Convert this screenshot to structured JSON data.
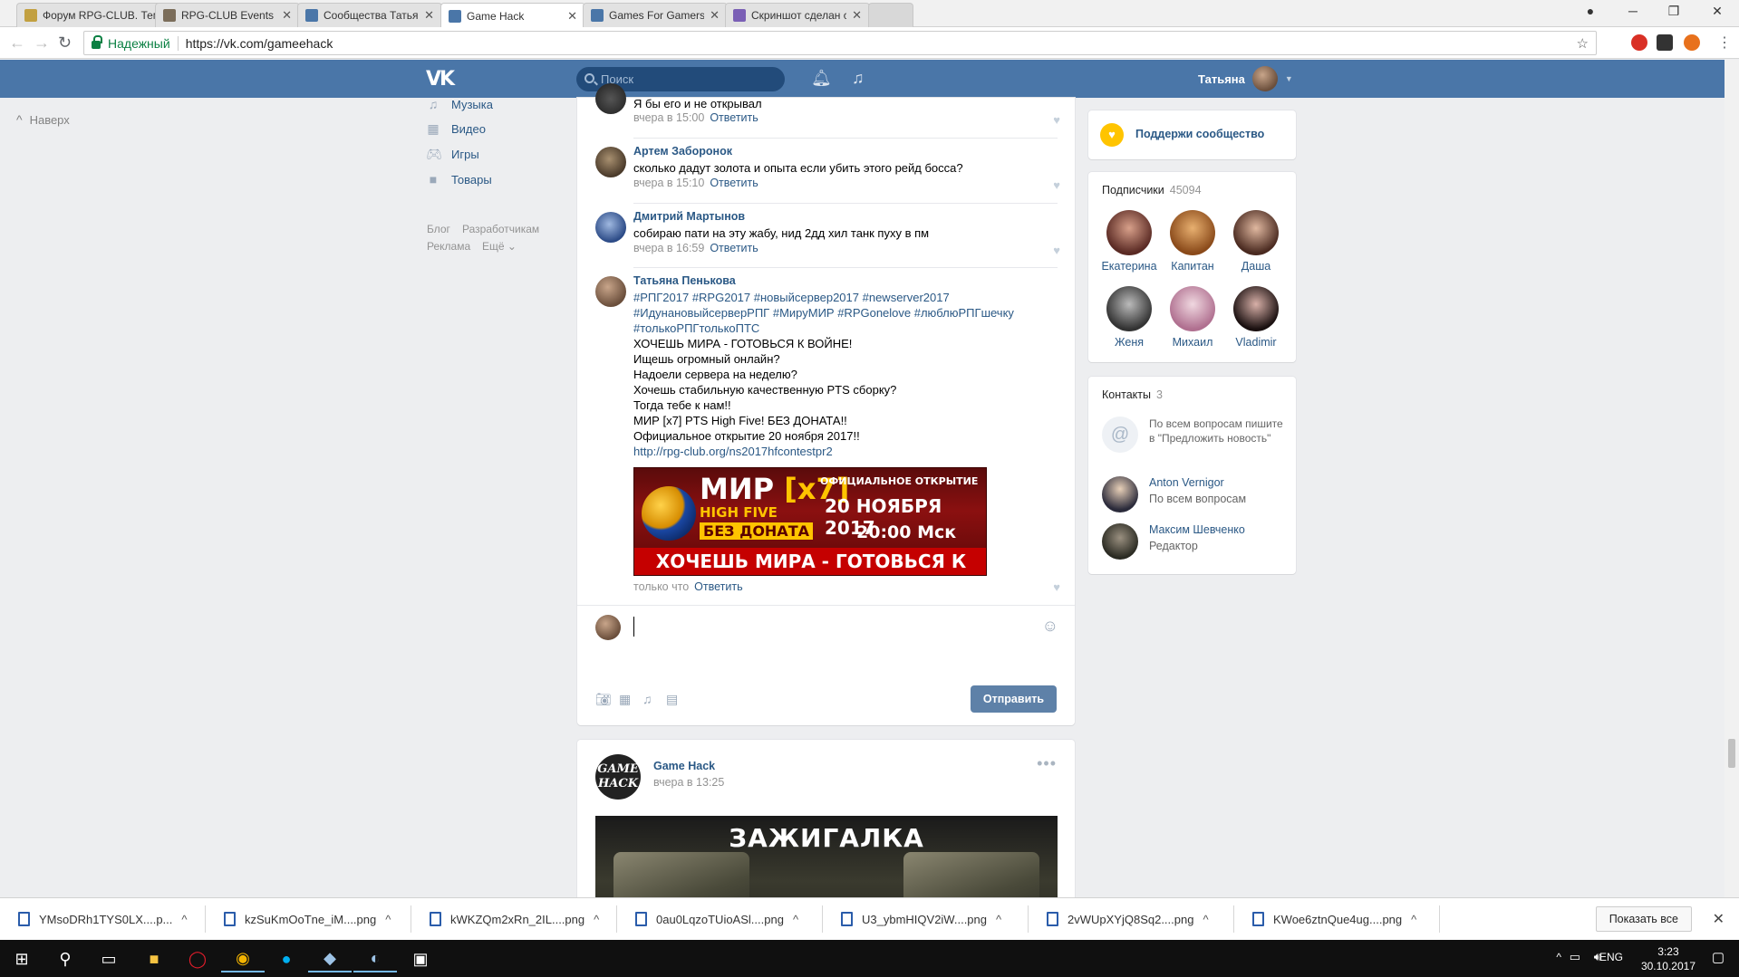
{
  "browser": {
    "tabs": [
      {
        "title": "Форум RPG-CLUB. Тема",
        "color": "#c2a040"
      },
      {
        "title": "RPG-CLUB Events Screen",
        "color": "#7b6d5a"
      },
      {
        "title": "Сообщества Татьяны П",
        "color": "#4a76a8"
      },
      {
        "title": "Game Hack",
        "color": "#4a76a8"
      },
      {
        "title": "Games For Gamers🔥",
        "color": "#4a76a8"
      },
      {
        "title": "Скриншот сделан с пом",
        "color": "#7a5fb5"
      }
    ],
    "secure_label": "Надежный",
    "url": "https://vk.com/gameehack"
  },
  "vk": {
    "search_placeholder": "Поиск",
    "user_name": "Татьяна",
    "up_label": "Наверх",
    "nav": [
      {
        "label": "Музыка",
        "icon": "music-icon"
      },
      {
        "label": "Видео",
        "icon": "video-icon"
      },
      {
        "label": "Игры",
        "icon": "games-icon"
      },
      {
        "label": "Товары",
        "icon": "goods-icon"
      }
    ],
    "footer_links": [
      "Блог",
      "Разработчикам",
      "Реклама",
      "Ещё"
    ]
  },
  "comments": [
    {
      "name": "",
      "text": "Я бы его и не открывал",
      "time": "вчера в 15:00",
      "reply": "Ответить"
    },
    {
      "name": "Артем Заборонок",
      "text": "сколько дадут золота и опыта если убить этого рейд босса?",
      "time": "вчера в 15:10",
      "reply": "Ответить"
    },
    {
      "name": "Дмитрий Мартынов",
      "text": "собираю пати на эту жабу, нид 2дд хил танк пуху в пм",
      "time": "вчера в 16:59",
      "reply": "Ответить"
    }
  ],
  "big_comment": {
    "name": "Татьяна Пенькова",
    "hashtags_1": "#РПГ2017 #RPG2017 #новыйсервер2017 #newserver2017",
    "hashtags_2": "#ИдунановыйсерверРПГ #МируМИР #RPGonelove #люблюРПГшечку",
    "hashtags_3": "#толькоРПГтолькоПТС",
    "lines": [
      "ХОЧЕШЬ МИРА - ГОТОВЬСЯ К ВОЙНЕ!",
      "Ищешь огромный онлайн?",
      "Надоели сервера на неделю?",
      "Хочешь стабильную качественную PTS сборку?",
      "Тогда тебе к нам!!",
      "МИР [x7] PTS High Five! БЕЗ ДОНАТА!!",
      "Официальное открытие 20 ноября 2017!!"
    ],
    "link": "http://rpg-club.org/ns2017hfcontestpr2",
    "banner": {
      "l1a": "МИР ",
      "l1b": "[x7]",
      "l2": "HIGH FIVE",
      "l3": "БЕЗ ДОНАТА",
      "l4": "ОФИЦИАЛЬНОЕ ОТКРЫТИЕ",
      "l5": "20 НОЯБРЯ 2017",
      "l6": "20:00 Мск",
      "l7": "ХОЧЕШЬ МИРА - ГОТОВЬСЯ К ВОЙНЕ"
    },
    "time": "только что",
    "reply": "Ответить"
  },
  "composer": {
    "send_label": "Отправить"
  },
  "post2": {
    "author": "Game Hack",
    "time": "вчера в 13:25",
    "logo_text_1": "GAME",
    "logo_text_2": "HACK",
    "image_title": "ЗАЖИГАЛКА"
  },
  "sidebar": {
    "support": "Поддержи сообщество",
    "members_label": "Подписчики",
    "members_count": "45094",
    "members": [
      "Екатерина",
      "Капитан",
      "Даша",
      "Женя",
      "Михаил",
      "Vladimir"
    ],
    "contacts_label": "Контакты",
    "contacts_count": "3",
    "contacts": [
      {
        "name": "",
        "role": "По всем вопросам пишите в \"Предложить новость\""
      },
      {
        "name": "Anton Vernigor",
        "role": "По всем вопросам"
      },
      {
        "name": "Максим Шевченко",
        "role": "Редактор"
      }
    ]
  },
  "downloads": {
    "files": [
      "YMsoDRh1TYS0LX....p...",
      "kzSuKmOoTne_iM....png",
      "kWKZQm2xRn_2IL....png",
      "0au0LqzoTUioASl....png",
      "U3_ybmHIQV2iW....png",
      "2vWUpXYjQ8Sq2....png",
      "KWoe6ztnQue4ug....png"
    ],
    "show_all": "Показать все"
  },
  "taskbar": {
    "lang": "ENG",
    "time": "3:23",
    "date": "30.10.2017"
  }
}
